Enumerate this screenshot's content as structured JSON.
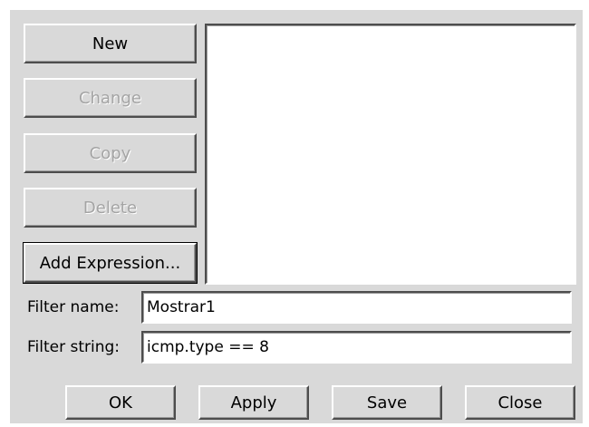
{
  "buttons": {
    "new": "New",
    "change": "Change",
    "copy": "Copy",
    "delete": "Delete",
    "add_expression": "Add Expression..."
  },
  "filter_list": {
    "items": []
  },
  "form": {
    "filter_name_label": "Filter name:",
    "filter_name_value": "Mostrar1",
    "filter_string_label": "Filter string:",
    "filter_string_value": "icmp.type == 8"
  },
  "footer": {
    "ok": "OK",
    "apply": "Apply",
    "save": "Save",
    "close": "Close"
  }
}
